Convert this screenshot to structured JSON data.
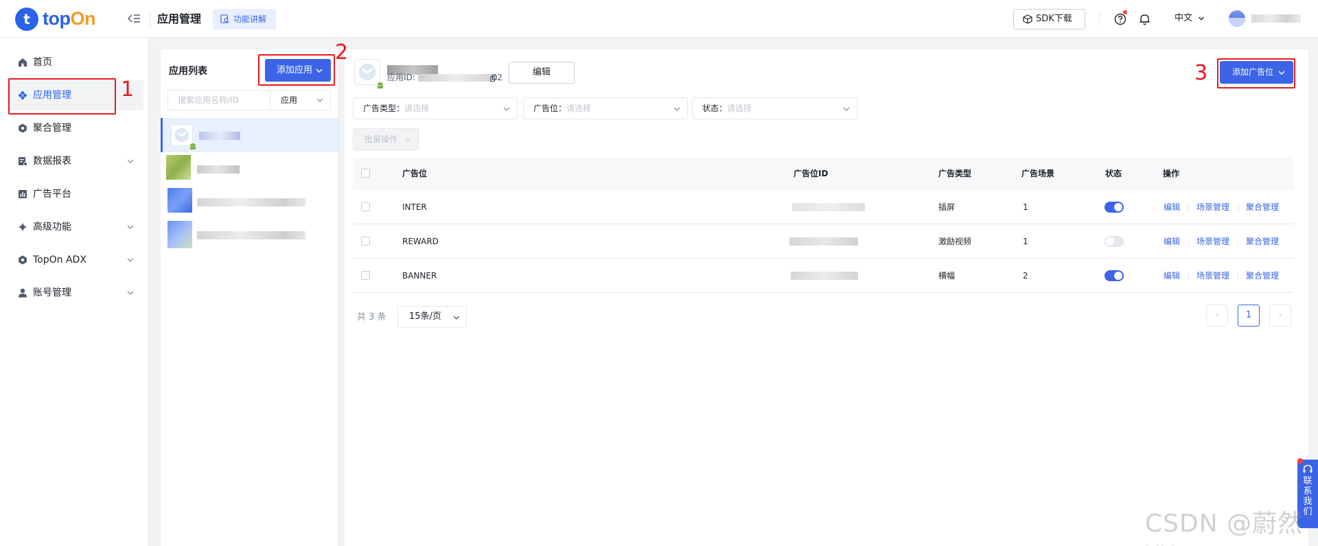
{
  "header": {
    "logo_mark": "t",
    "logo_text_a": "top",
    "logo_text_b": "On",
    "page_title": "应用管理",
    "feature_button": "功能讲解",
    "sdk_button": "SDK下载",
    "language": "中文"
  },
  "sidebar": {
    "items": [
      {
        "label": "首页",
        "icon": "home-icon",
        "has_chevron": false
      },
      {
        "label": "应用管理",
        "icon": "app-diamond-icon",
        "has_chevron": false,
        "active": true
      },
      {
        "label": "聚合管理",
        "icon": "hexagon-icon",
        "has_chevron": false
      },
      {
        "label": "数据报表",
        "icon": "report-icon",
        "has_chevron": true
      },
      {
        "label": "广告平台",
        "icon": "bar-chart-icon",
        "has_chevron": false
      },
      {
        "label": "高级功能",
        "icon": "sparkle-icon",
        "has_chevron": true
      },
      {
        "label": "TopOn ADX",
        "icon": "hexagon-icon",
        "has_chevron": true
      },
      {
        "label": "账号管理",
        "icon": "user-icon",
        "has_chevron": true
      }
    ]
  },
  "app_list": {
    "title": "应用列表",
    "add_button": "添加应用",
    "search_placeholder": "搜索应用名称/ID",
    "type_select": "应用"
  },
  "app_detail": {
    "id_label": "应用ID: ",
    "id_suffix": "02",
    "edit_button": "编辑",
    "add_ad_button": "添加广告位"
  },
  "filters": [
    {
      "label": "广告类型：",
      "placeholder": "请选择"
    },
    {
      "label": "广告位：",
      "placeholder": "请选择"
    },
    {
      "label": "状态：",
      "placeholder": "请选择"
    }
  ],
  "batch_button": "批量操作",
  "table": {
    "headers": [
      "广告位",
      "广告位ID",
      "广告类型",
      "广告场景",
      "状态",
      "操作"
    ],
    "rows": [
      {
        "name": "INTER",
        "ad_type": "插屏",
        "scenes": "1",
        "enabled": true
      },
      {
        "name": "REWARD",
        "ad_type": "激励视频",
        "scenes": "1",
        "enabled": false
      },
      {
        "name": "BANNER",
        "ad_type": "横幅",
        "scenes": "2",
        "enabled": true
      }
    ],
    "actions": [
      "编辑",
      "场景管理",
      "聚合管理"
    ]
  },
  "pagination": {
    "total": "共 3 条",
    "page_size": "15条/页",
    "current_page": "1",
    "prev": "‹",
    "next": "›"
  },
  "contact": "联系我们",
  "annotations": [
    "1",
    "2",
    "3"
  ],
  "annotation_color": "#e8171d",
  "accent_color": "#3b64e6",
  "watermark": "CSDN @蔚然vy"
}
